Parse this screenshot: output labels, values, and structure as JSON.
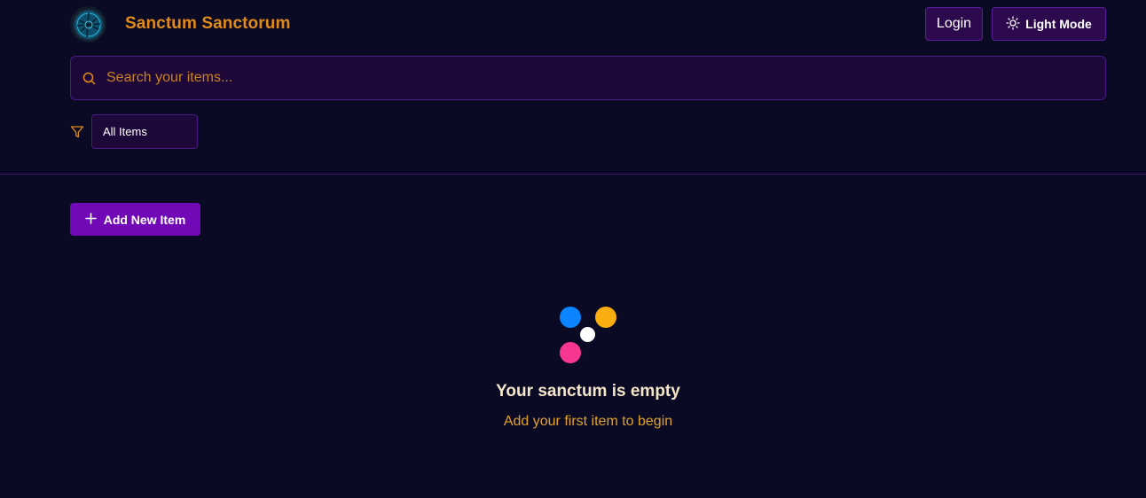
{
  "header": {
    "app_title": "Sanctum Sanctorum",
    "login_label": "Login",
    "theme_label": "Light Mode"
  },
  "search": {
    "placeholder": "Search your items...",
    "value": ""
  },
  "filter": {
    "selected": "All Items"
  },
  "actions": {
    "add_label": "Add New Item"
  },
  "empty_state": {
    "title": "Your sanctum is empty",
    "subtitle": "Add your first item to begin"
  },
  "colors": {
    "background": "#0a0a25",
    "accent_orange": "#e08a17",
    "accent_purple": "#7209b7",
    "dot_blue": "#0a84ff",
    "dot_yellow": "#f9ad0e",
    "dot_pink": "#f7378f",
    "dot_white": "#ffffff"
  },
  "icons": {
    "logo": "sanctum-logo-icon",
    "theme": "sun-icon",
    "search": "search-icon",
    "filter": "filter-icon",
    "add": "plus-icon"
  }
}
